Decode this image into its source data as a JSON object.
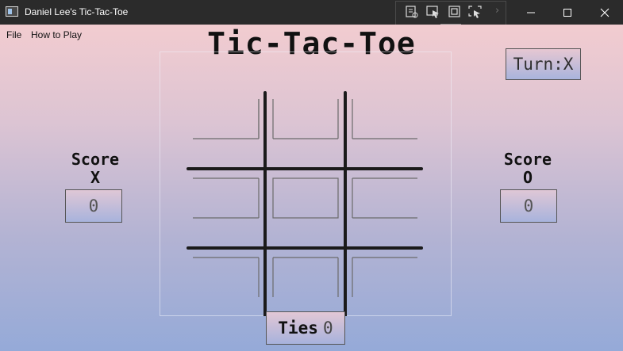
{
  "window": {
    "title": "Daniel Lee's Tic-Tac-Toe",
    "icon": "app-window-icon",
    "controls": [
      "minimize-icon",
      "maximize-icon",
      "close-icon"
    ]
  },
  "debug_toolbar": {
    "buttons": [
      "visual-tree-icon",
      "select-element-icon",
      "display-layout-adorners-icon",
      "track-focused-element-icon"
    ],
    "overflow": "›"
  },
  "menu": {
    "items": [
      "File",
      "How to Play"
    ]
  },
  "game": {
    "title": "Tic-Tac-Toe",
    "turn_label": "Turn:",
    "turn_player": "X",
    "turn_text": "Turn:X",
    "score_x": {
      "label": "Score",
      "player": "X",
      "value": "0"
    },
    "score_o": {
      "label": "Score",
      "player": "O",
      "value": "0"
    },
    "ties": {
      "label": "Ties",
      "value": "0"
    },
    "cells": [
      "",
      "",
      "",
      "",
      "",
      "",
      "",
      "",
      ""
    ]
  },
  "colors": {
    "titlebar": "#2b2b2b",
    "gradient_top": "#f2ccd0",
    "gradient_bottom": "#95aad8",
    "grid_line": "#1a1a1a"
  }
}
